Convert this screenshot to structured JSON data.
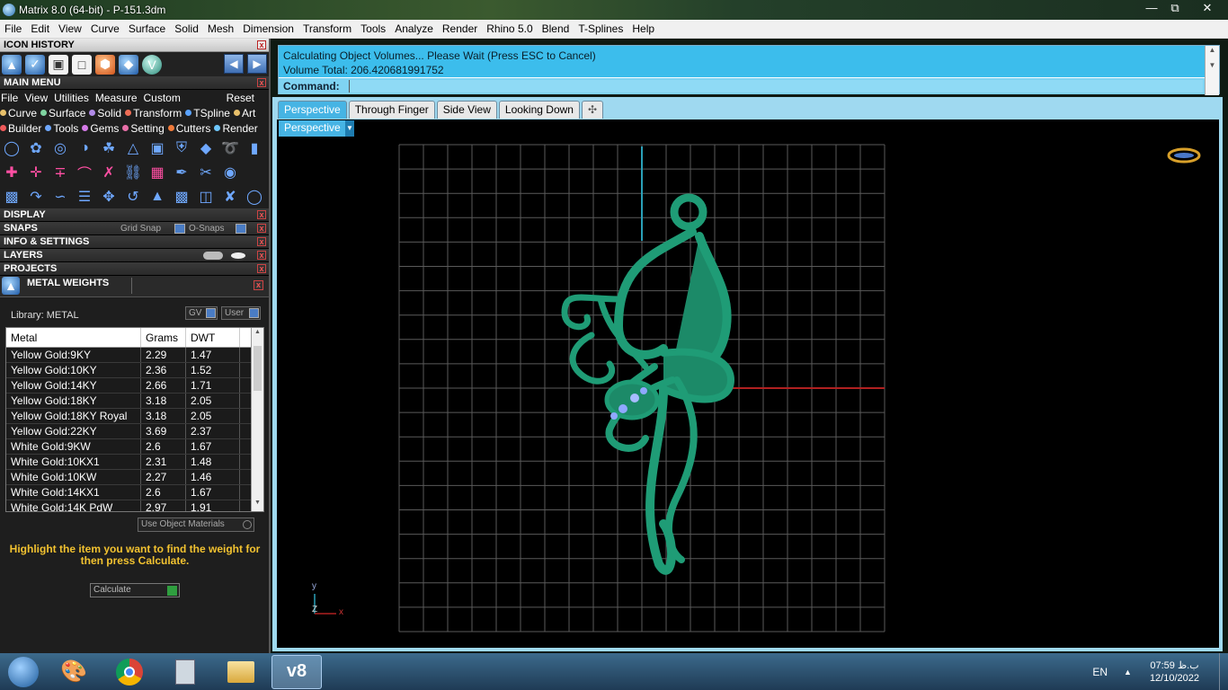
{
  "window": {
    "title": "Matrix 8.0 (64-bit) - P-151.3dm"
  },
  "menubar": [
    "File",
    "Edit",
    "View",
    "Curve",
    "Surface",
    "Solid",
    "Mesh",
    "Dimension",
    "Transform",
    "Tools",
    "Analyze",
    "Render",
    "Rhino 5.0",
    "Blend",
    "T-Splines",
    "Help"
  ],
  "panel": {
    "icon_history": "ICON HISTORY",
    "main_menu": "MAIN MENU",
    "mm_items": [
      "File",
      "View",
      "Utilities",
      "Measure",
      "Custom"
    ],
    "reset": "Reset",
    "cat_row1": [
      {
        "label": "Curve",
        "color": "#e8c06a"
      },
      {
        "label": "Surface",
        "color": "#7fd3a0"
      },
      {
        "label": "Solid",
        "color": "#b18be8"
      },
      {
        "label": "Transform",
        "color": "#f06d55"
      },
      {
        "label": "TSpline",
        "color": "#5aa3ff"
      },
      {
        "label": "Art",
        "color": "#e8c06a"
      }
    ],
    "cat_row2": [
      {
        "label": "Builder",
        "color": "#f05a5a"
      },
      {
        "label": "Tools",
        "color": "#6fa8ff"
      },
      {
        "label": "Gems",
        "color": "#d57ae8"
      },
      {
        "label": "Setting",
        "color": "#e86fa8"
      },
      {
        "label": "Cutters",
        "color": "#f07a3a"
      },
      {
        "label": "Render",
        "color": "#6fc8ff"
      }
    ],
    "display": "DISPLAY",
    "snaps": "SNAPS",
    "grid_snap": "Grid Snap",
    "o_snaps": "O-Snaps",
    "info_settings": "INFO & SETTINGS",
    "layers": "LAYERS",
    "projects": "PROJECTS",
    "metal_weights": "METAL WEIGHTS",
    "library": "Library: METAL",
    "gv": "GV",
    "user": "User",
    "columns": [
      "Metal",
      "Grams",
      "DWT"
    ],
    "rows": [
      [
        "Yellow Gold:9KY",
        "2.29",
        "1.47"
      ],
      [
        "Yellow Gold:10KY",
        "2.36",
        "1.52"
      ],
      [
        "Yellow Gold:14KY",
        "2.66",
        "1.71"
      ],
      [
        "Yellow Gold:18KY",
        "3.18",
        "2.05"
      ],
      [
        "Yellow Gold:18KY Royal",
        "3.18",
        "2.05"
      ],
      [
        "Yellow Gold:22KY",
        "3.69",
        "2.37"
      ],
      [
        "White Gold:9KW",
        "2.6",
        "1.67"
      ],
      [
        "White Gold:10KX1",
        "2.31",
        "1.48"
      ],
      [
        "White Gold:10KW",
        "2.27",
        "1.46"
      ],
      [
        "White Gold:14KX1",
        "2.6",
        "1.67"
      ],
      [
        "White Gold:14K PdW",
        "2.97",
        "1.91"
      ]
    ],
    "use_object_materials": "Use Object Materials",
    "hint": "Highlight the item you want to find the weight for then press Calculate.",
    "calculate": "Calculate"
  },
  "command": {
    "line1": "Calculating Object Volumes... Please Wait (Press ESC to Cancel)",
    "line2": "Volume Total: 206.420681991752",
    "prompt": "Command:"
  },
  "tabs": [
    "Perspective",
    "Through Finger",
    "Side View",
    "Looking Down"
  ],
  "tab_plus": "✣",
  "viewport": {
    "label": "Perspective",
    "axis_y": "y",
    "axis_z": "Z",
    "axis_x": "x"
  },
  "taskbar": {
    "lang": "EN",
    "time": "07:59 ب.ظ",
    "date": "12/10/2022"
  },
  "colors": {
    "command_bg": "#3cbdec",
    "tab_active": "#46b4e4",
    "model": "#1f9c76",
    "hint": "#f2c230"
  }
}
